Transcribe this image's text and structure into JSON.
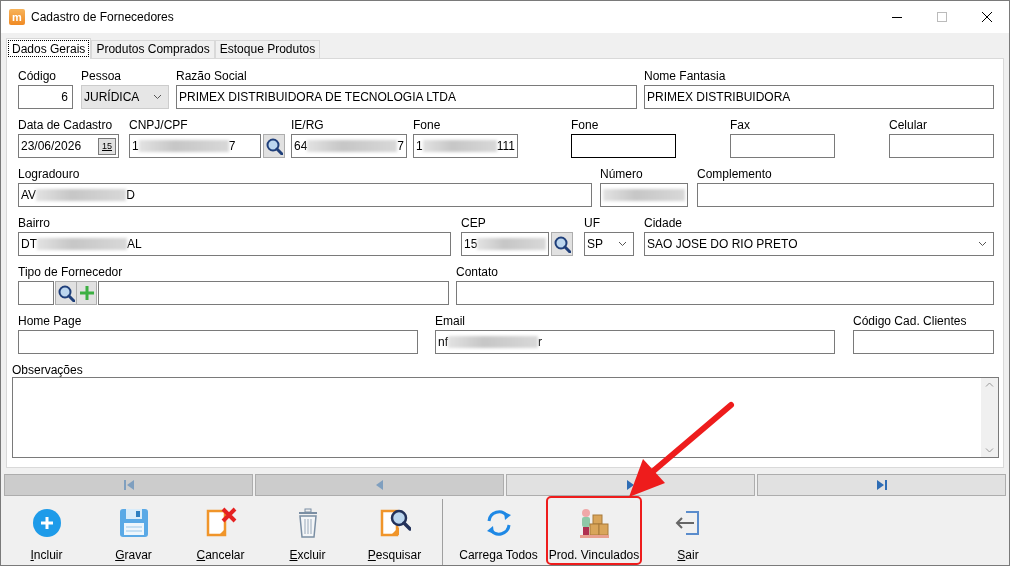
{
  "window": {
    "logo": "m",
    "title": "Cadastro de Fornecedores"
  },
  "tabs": [
    {
      "label": "Dados Gerais",
      "selected": true
    },
    {
      "label": "Produtos Comprados",
      "selected": false
    },
    {
      "label": "Estoque Produtos",
      "selected": false
    }
  ],
  "rows": [
    {
      "fields": [
        {
          "kind": "number",
          "label": "Código",
          "value": "6"
        },
        {
          "kind": "select",
          "label": "Pessoa",
          "value": "JURÍDICA",
          "disabled": true
        },
        {
          "kind": "text",
          "label": "Razão Social",
          "value": "PRIMEX DISTRIBUIDORA DE TECNOLOGIA LTDA"
        },
        {
          "kind": "text",
          "label": "Nome Fantasia",
          "value": "PRIMEX DISTRIBUIDORA"
        }
      ]
    },
    {
      "fields": [
        {
          "kind": "date",
          "label": "Data de Cadastro",
          "value": "23/06/2026",
          "button": "15"
        },
        {
          "kind": "lookup",
          "label": "CNPJ/CPF",
          "value": "1",
          "redacted": true,
          "value_end": "7"
        },
        {
          "kind": "text",
          "label": "IE/RG",
          "value": "64",
          "redacted": true,
          "value_end": "7"
        },
        {
          "kind": "text",
          "label": "Fone",
          "value": "1",
          "redacted": true,
          "value_end": "111"
        },
        {
          "kind": "text",
          "label": "Fone",
          "focused": true
        },
        {
          "kind": "text",
          "label": "Fax"
        },
        {
          "kind": "text",
          "label": "Celular"
        }
      ]
    },
    {
      "fields": [
        {
          "kind": "text",
          "label": "Logradouro",
          "value": "AV",
          "redacted": true,
          "value_end": "D"
        },
        {
          "kind": "text",
          "label": "Número",
          "redacted": true
        },
        {
          "kind": "text",
          "label": "Complemento"
        }
      ]
    },
    {
      "fields": [
        {
          "kind": "text",
          "label": "Bairro",
          "value": "DT",
          "redacted": true,
          "value_end": "AL"
        },
        {
          "kind": "lookup",
          "label": "CEP",
          "value": "15",
          "redacted": true
        },
        {
          "kind": "select",
          "label": "UF",
          "value": "SP",
          "disabled": false
        },
        {
          "kind": "select",
          "label": "Cidade",
          "value": "SAO JOSE DO RIO PRETO",
          "disabled": false
        }
      ]
    },
    {
      "fields": [
        {
          "kind": "code-lookup",
          "label": "Tipo de Fornecedor"
        },
        {
          "kind": "text",
          "label": "Contato"
        }
      ]
    },
    {
      "fields": [
        {
          "kind": "text",
          "label": "Home Page"
        },
        {
          "kind": "text",
          "label": "Email",
          "value": "nf",
          "redacted": true,
          "value_end": "r"
        },
        {
          "kind": "text",
          "label": "Código Cad. Clientes"
        }
      ]
    }
  ],
  "notes": {
    "label": "Observações"
  },
  "navigator": [
    {
      "disabled": true
    },
    {
      "disabled": true
    },
    {
      "disabled": false
    },
    {
      "disabled": false
    }
  ],
  "toolbar": [
    {
      "label": "Incluir",
      "underline_first": true,
      "highlighted": false
    },
    {
      "label": "Gravar",
      "underline_first": true,
      "highlighted": false
    },
    {
      "label": "Cancelar",
      "underline_first": true,
      "highlighted": false
    },
    {
      "label": "Excluir",
      "underline_first": true,
      "highlighted": false
    },
    {
      "label": "Pesquisar",
      "underline_first": true,
      "highlighted": false
    },
    {
      "label": "Carrega Todos",
      "underline_first": false,
      "highlighted": false
    },
    {
      "label": "Prod. Vinculados",
      "underline_first": false,
      "highlighted": true
    },
    {
      "label": "Sair",
      "underline_first": true,
      "highlighted": false
    }
  ]
}
